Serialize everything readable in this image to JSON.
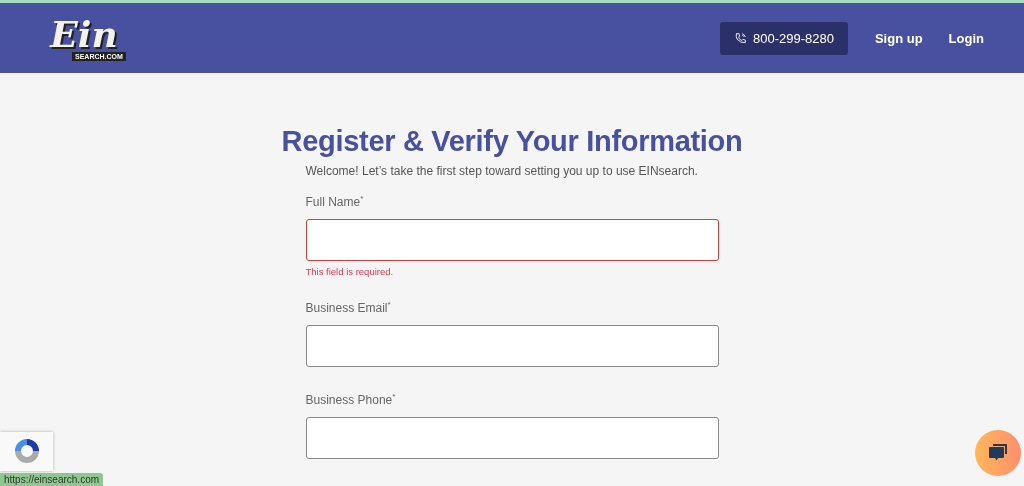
{
  "header": {
    "logo": {
      "word": "Ein",
      "tag": "SEARCH.COM"
    },
    "phone": "800-299-8280",
    "nav": [
      "Sign up",
      "Login"
    ]
  },
  "form": {
    "title": "Register & Verify Your Information",
    "intro": "Welcome! Let’s take the first step toward setting you up to use EINsearch.",
    "fields": [
      {
        "label": "Full Name",
        "required_mark": "*",
        "error": true,
        "error_text": "This field is required."
      },
      {
        "label": "Business Email",
        "required_mark": "*",
        "error": false
      },
      {
        "label": "Business Phone",
        "required_mark": "*",
        "error": false
      }
    ]
  },
  "status_bar": "https://einsearch.com"
}
